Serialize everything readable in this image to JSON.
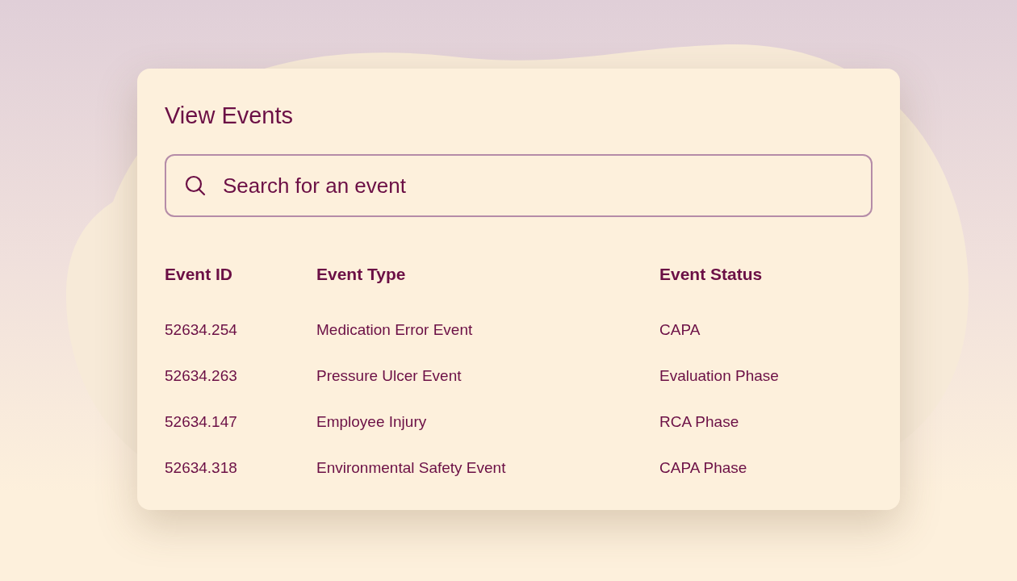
{
  "title": "View Events",
  "search": {
    "placeholder": "Search for an event"
  },
  "table": {
    "columns": [
      "Event ID",
      "Event Type",
      "Event Status"
    ],
    "rows": [
      [
        "52634.254",
        "Medication Error Event",
        "CAPA"
      ],
      [
        "52634.263",
        "Pressure Ulcer Event",
        "Evaluation Phase"
      ],
      [
        "52634.147",
        "Employee Injury",
        "RCA Phase"
      ],
      [
        "52634.318",
        "Environmental Safety Event",
        "CAPA Phase"
      ]
    ]
  }
}
